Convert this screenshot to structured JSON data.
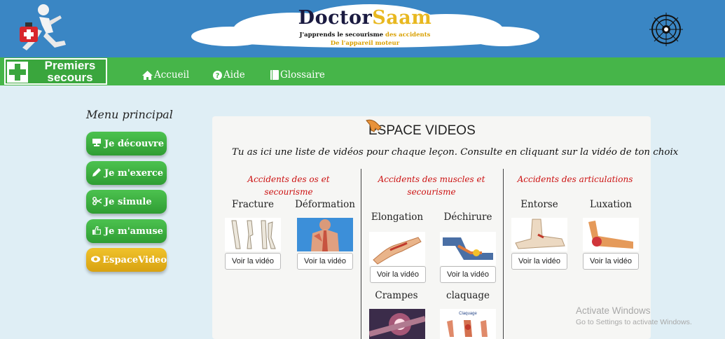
{
  "header": {
    "title_part1": "Doctor",
    "title_part2": "Saam",
    "subtitle_line1": "J'apprends le secourisme",
    "subtitle_line1_accent": "des accidents",
    "subtitle_line2": "De l'appareil moteur",
    "banner_color": "#3a86c4"
  },
  "brand": {
    "line1": "Premiers",
    "line2": "secours",
    "icon": "first-aid-cross-icon"
  },
  "nav": {
    "color": "#46b549",
    "items": [
      {
        "label": "Accueil",
        "icon": "home-icon"
      },
      {
        "label": "Aide",
        "icon": "question-icon"
      },
      {
        "label": "Glossaire",
        "icon": "book-icon"
      }
    ]
  },
  "sidebar": {
    "title": "Menu principal",
    "buttons": [
      {
        "label": "Je découvre",
        "icon": "board-icon",
        "color": "#3cae3f"
      },
      {
        "label": "Je m'exerce",
        "icon": "pencil-icon",
        "color": "#3cae3f"
      },
      {
        "label": "Je simule",
        "icon": "scissors-icon",
        "color": "#3cae3f"
      },
      {
        "label": "Je m'amuse",
        "icon": "thumbs-up-icon",
        "color": "#3cae3f"
      },
      {
        "label": "EspaceVideo",
        "icon": "eye-icon",
        "color": "#e3ae18"
      }
    ]
  },
  "main": {
    "title": "ESPACE VIDEOS",
    "intro": "Tu as ici une liste de vidéos pour chaque leçon. Consulte en cliquant sur la vidéo de ton choix",
    "button_label": "Voir la vidéo",
    "categories": [
      {
        "title": "Accidents des os et secourisme",
        "videos": [
          "Fracture",
          "Déformation"
        ]
      },
      {
        "title_line1": "Accidents des muscles et",
        "title_line2": "secourisme",
        "videos": [
          "Elongation",
          "Déchirure",
          "Crampes",
          "claquage"
        ]
      },
      {
        "title": "Accidents des articulations",
        "videos": [
          "Entorse",
          "Luxation"
        ]
      }
    ],
    "claquage_thumb_label": "Claquage"
  },
  "watermark": {
    "line1": "Activate Windows",
    "line2": "Go to Settings to activate Windows."
  }
}
